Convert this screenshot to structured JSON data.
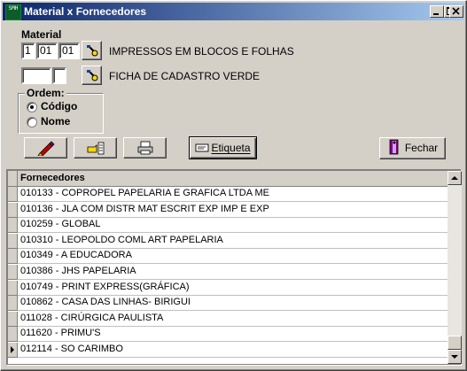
{
  "window": {
    "title": "Material x Fornecedores",
    "app_icon_text": "SMH"
  },
  "material": {
    "label": "Material",
    "code1": "1",
    "code2": "01",
    "code3": "01",
    "description": "IMPRESSOS EM BLOCOS E FOLHAS",
    "sub_code1": "",
    "sub_code2": "",
    "sub_description": "FICHA DE CADASTRO VERDE"
  },
  "ordem": {
    "title": "Ordem:",
    "options": [
      {
        "label": "Código",
        "selected": true
      },
      {
        "label": "Nome",
        "selected": false
      }
    ]
  },
  "toolbar": {
    "etiqueta_label": "Etiqueta",
    "fechar_label": "Fechar"
  },
  "grid": {
    "column_header": "Fornecedores",
    "rows": [
      "010133  -  COPROPEL PAPELARIA E GRAFICA LTDA ME",
      "010136  -  JLA COM DISTR MAT ESCRIT EXP IMP E EXP",
      "010259  -  GLOBAL",
      "010310  -  LEOPOLDO COML ART PAPELARIA",
      "010349  -  A EDUCADORA",
      "010386  -  JHS PAPELARIA",
      "010749  -  PRINT EXPRESS(GRÁFICA)",
      "010862  -  CASA DAS LINHAS- BIRIGUI",
      "011028  -  CIRÚRGICA PAULISTA",
      "011620  -  PRIMU'S",
      "012114  -  SO CARIMBO"
    ],
    "current_row_index": 10
  },
  "colors": {
    "title_start": "#0a246a",
    "title_end": "#a6caf0",
    "face": "#d4d0c8"
  }
}
